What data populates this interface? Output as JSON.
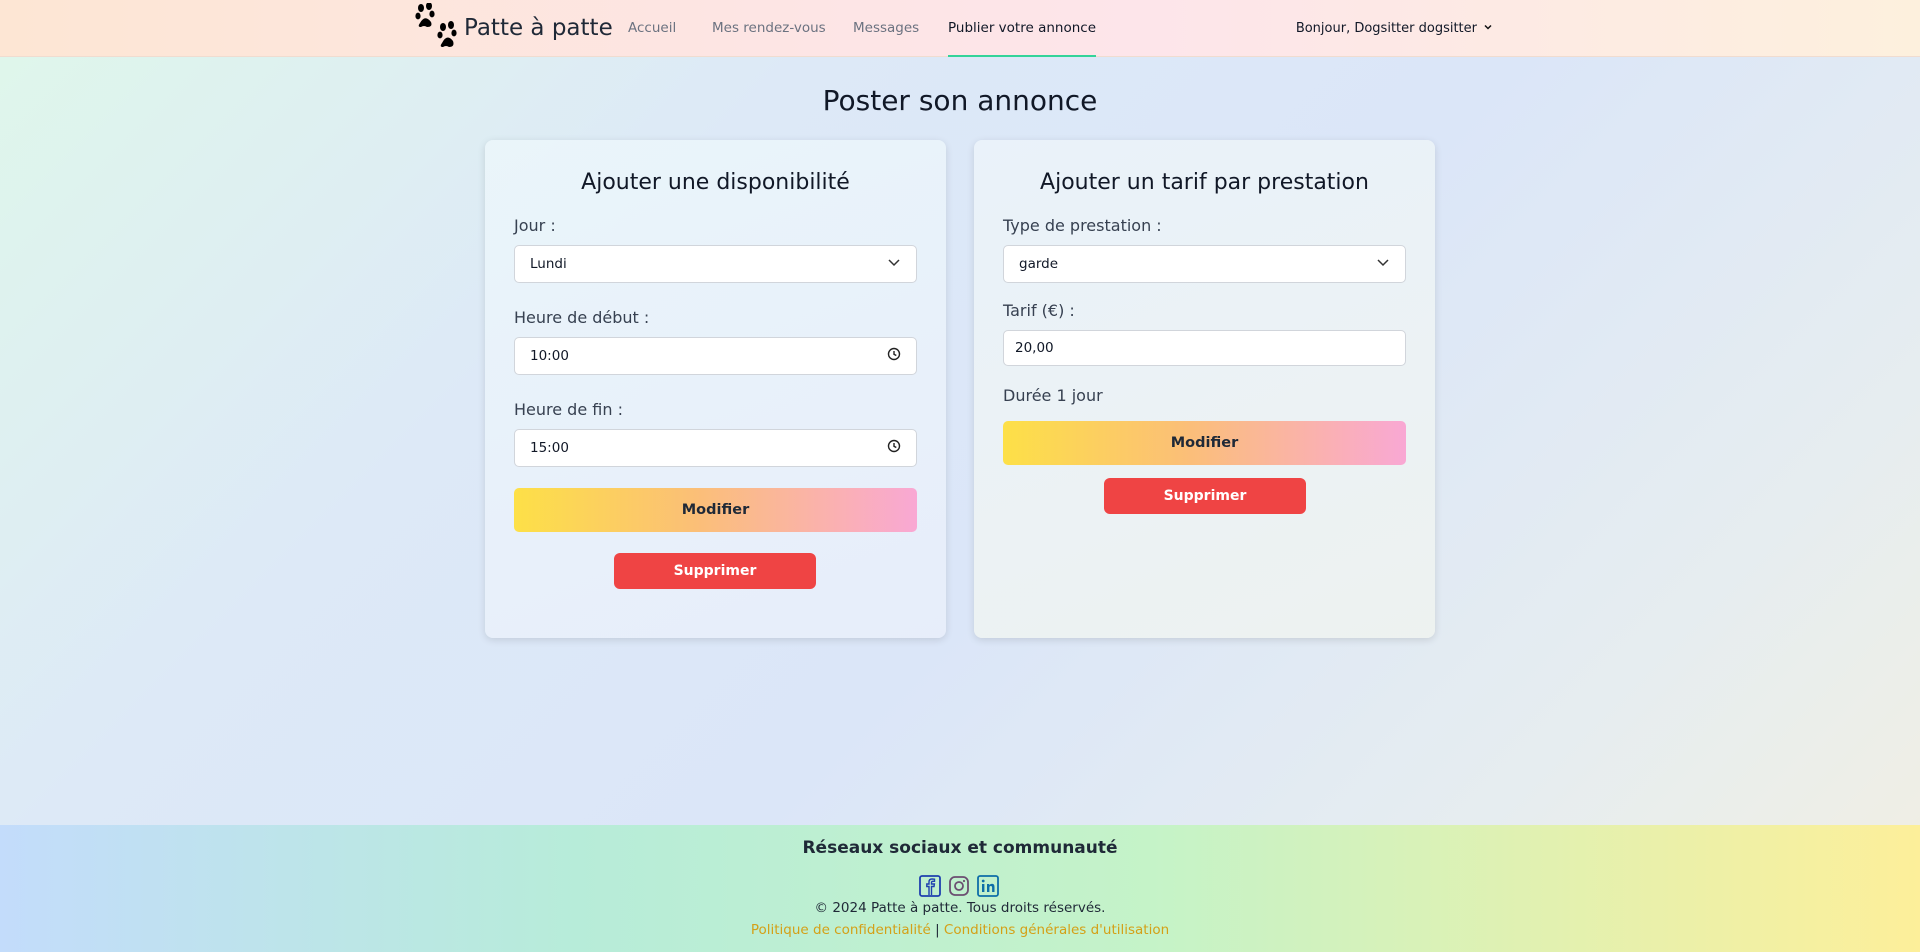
{
  "header": {
    "brand": "Patte à patte",
    "nav": [
      "Accueil",
      "Mes rendez-vous",
      "Messages",
      "Publier votre annonce"
    ],
    "active_nav": "Publier votre annonce",
    "user_greeting": "Bonjour, Dogsitter dogsitter"
  },
  "page_title": "Poster son annonce",
  "availability": {
    "title": "Ajouter une disponibilité",
    "day_label": "Jour :",
    "day_value": "Lundi",
    "start_label": "Heure de début :",
    "start_value": "10:00",
    "end_label": "Heure de fin :",
    "end_value": "15:00",
    "modify_button": "Modifier",
    "delete_button": "Supprimer"
  },
  "pricing": {
    "title": "Ajouter un tarif par prestation",
    "type_label": "Type de prestation :",
    "type_value": "garde",
    "price_label": "Tarif (€) :",
    "price_value": "20,00",
    "duration_text": "Durée 1 jour",
    "modify_button": "Modifier",
    "delete_button": "Supprimer"
  },
  "footer": {
    "title": "Réseaux sociaux et communauté",
    "social_icons": [
      "facebook-icon",
      "instagram-icon",
      "linkedin-icon"
    ],
    "copyright": "© 2024 Patte à patte. Tous droits réservés.",
    "privacy_link": "Politique de confidentialité",
    "separator": "|",
    "terms_link": "Conditions générales d'utilisation"
  },
  "colors": {
    "accent_green": "#34d399",
    "danger_red": "#ef4444",
    "link_gold": "#d4a017"
  }
}
